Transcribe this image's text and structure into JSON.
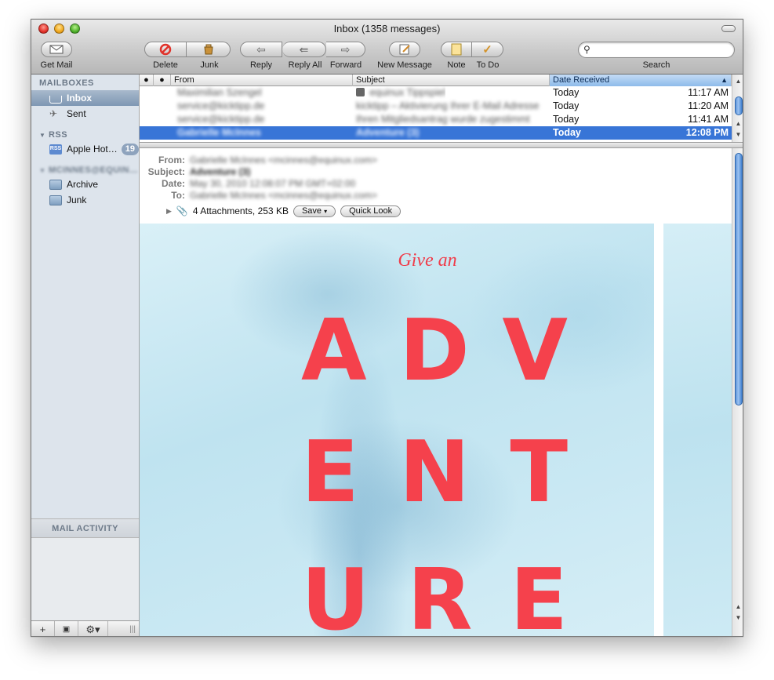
{
  "window": {
    "title": "Inbox (1358 messages)"
  },
  "toolbar": {
    "get_mail": "Get Mail",
    "delete": "Delete",
    "junk": "Junk",
    "reply": "Reply",
    "reply_all": "Reply All",
    "forward": "Forward",
    "new_message": "New Message",
    "note": "Note",
    "todo": "To Do",
    "search": "Search"
  },
  "sidebar": {
    "mailboxes_header": "MAILBOXES",
    "inbox": "Inbox",
    "sent": "Sent",
    "rss_header": "RSS",
    "rss_feed": "Apple Hot…",
    "rss_badge": "19",
    "rss_icon": "RSS",
    "account_header": "MCINNES@EQUIN…",
    "archive": "Archive",
    "junk": "Junk",
    "activity_header": "MAIL ACTIVITY"
  },
  "list": {
    "columns": {
      "from": "From",
      "subject": "Subject",
      "date": "Date Received"
    },
    "rows": [
      {
        "from": "Maximilian Szengel",
        "subject": "equinux Tippspiel",
        "day": "Today",
        "time": "11:17 AM"
      },
      {
        "from": "service@kicktipp.de",
        "subject": "kicktipp – Aktivierung Ihrer E-Mail Adresse",
        "day": "Today",
        "time": "11:20 AM"
      },
      {
        "from": "service@kicktipp.de",
        "subject": "Ihren Mitgliedsantrag wurde zugestimmt",
        "day": "Today",
        "time": "11:41 AM"
      },
      {
        "from": "Gabrielle McInnes",
        "subject": "Adventure (3)",
        "day": "Today",
        "time": "12:08 PM"
      }
    ]
  },
  "message": {
    "from_label": "From:",
    "from": "Gabrielle McInnes <mcinnes@equinux.com>",
    "subject_label": "Subject:",
    "subject": "Adventure (3)",
    "date_label": "Date:",
    "date": "May 30, 2010 12:08:07 PM GMT+02:00",
    "to_label": "To:",
    "to": "Gabrielle McInnes <mcinnes@equinux.com>",
    "attachments": "4 Attachments, 253 KB",
    "save": "Save",
    "quick_look": "Quick Look",
    "poster_give": "Give an",
    "poster_lines": [
      [
        "A",
        "D",
        "V"
      ],
      [
        "E",
        "N",
        "T"
      ],
      [
        "U",
        "R",
        "E"
      ]
    ]
  },
  "colors": {
    "accent": "#3875d7",
    "poster_red": "#f5414c",
    "poster_bg": "#cfe9f3"
  }
}
